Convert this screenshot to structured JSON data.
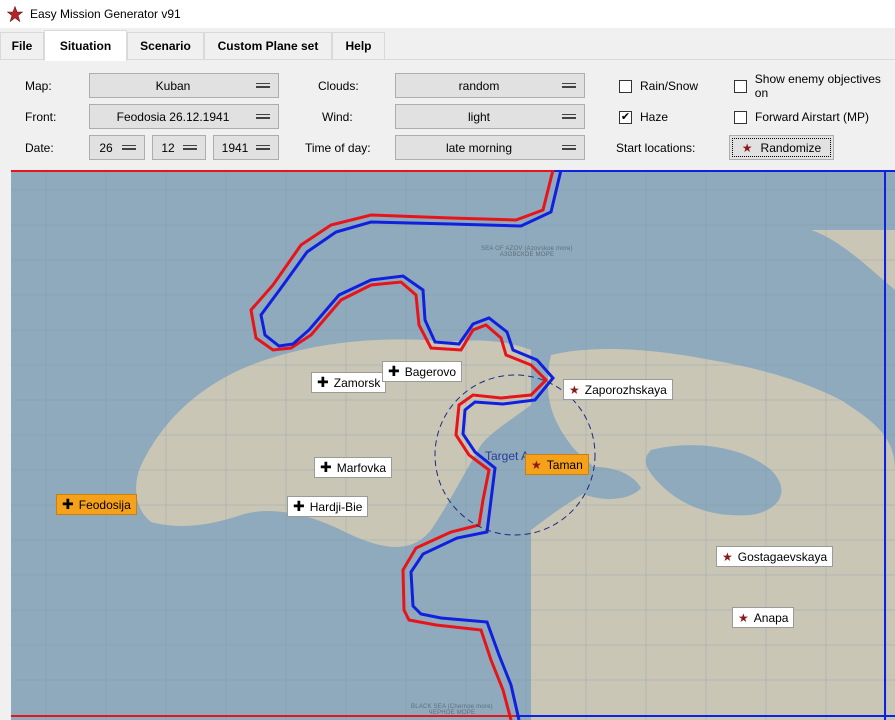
{
  "window": {
    "title": "Easy Mission Generator v91",
    "icon": "red-star-icon"
  },
  "tabs": [
    {
      "label": "File"
    },
    {
      "label": "Situation"
    },
    {
      "label": "Scenario"
    },
    {
      "label": "Custom Plane set"
    },
    {
      "label": "Help"
    }
  ],
  "active_tab": "Situation",
  "form": {
    "map_label": "Map:",
    "map_value": "Kuban",
    "front_label": "Front:",
    "front_value": "Feodosia 26.12.1941",
    "date_label": "Date:",
    "date_day": "26",
    "date_month": "12",
    "date_year": "1941",
    "clouds_label": "Clouds:",
    "clouds_value": "random",
    "wind_label": "Wind:",
    "wind_value": "light",
    "time_label": "Time of day:",
    "time_value": "late morning",
    "rain_label": "Rain/Snow",
    "rain_checked": false,
    "haze_label": "Haze",
    "haze_checked": true,
    "show_enemy_label": "Show enemy objectives on",
    "show_enemy_checked": false,
    "forward_label": "Forward Airstart (MP)",
    "forward_checked": false,
    "start_locations_label": "Start locations:",
    "randomize_label": "Randomize"
  },
  "map": {
    "sea_labels": [
      "SEA OF AZOV (Azovskoe more)",
      "АЗОВСКОЕ МОРЕ",
      "BLACK SEA (Chernoe more)",
      "ЧЕРНОЕ МОРЕ"
    ],
    "target_label": "Target A",
    "colors": {
      "water": "#8faabc",
      "land": "#c9c6b6",
      "front_red": "#e8141c",
      "front_blue": "#1020e0",
      "selected": "#f5a11a"
    },
    "markers": [
      {
        "label": "Feodosija",
        "side": "german",
        "icon": "cross-icon",
        "selected": true
      },
      {
        "label": "Zamorsk",
        "side": "german",
        "icon": "cross-icon",
        "selected": false
      },
      {
        "label": "Bagerovo",
        "side": "german",
        "icon": "cross-icon",
        "selected": false
      },
      {
        "label": "Marfovka",
        "side": "german",
        "icon": "cross-icon",
        "selected": false
      },
      {
        "label": "Hardji-Bie",
        "side": "german",
        "icon": "cross-icon",
        "selected": false
      },
      {
        "label": "Zaporozhskaya",
        "side": "soviet",
        "icon": "star-icon",
        "selected": false
      },
      {
        "label": "Taman",
        "side": "soviet",
        "icon": "star-icon",
        "selected": true
      },
      {
        "label": "Gostagaevskaya",
        "side": "soviet",
        "icon": "star-icon",
        "selected": false
      },
      {
        "label": "Anapa",
        "side": "soviet",
        "icon": "star-icon",
        "selected": false
      }
    ]
  }
}
